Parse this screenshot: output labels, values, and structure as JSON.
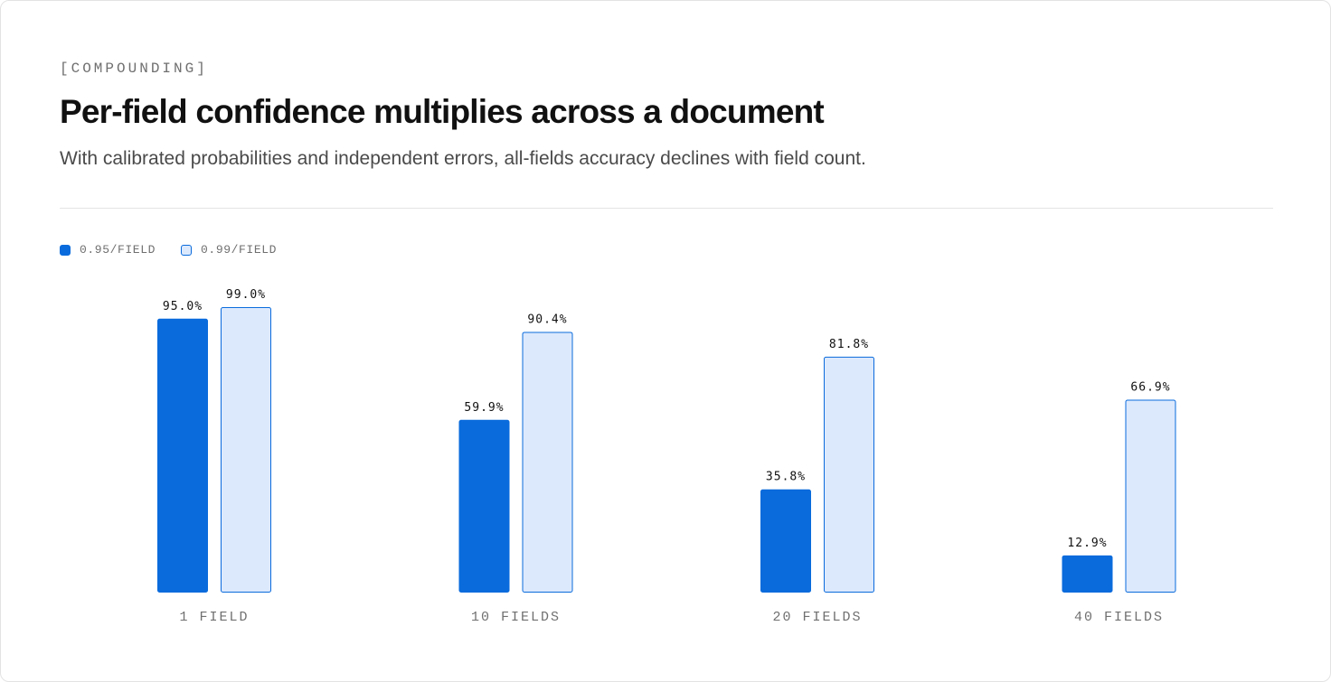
{
  "eyebrow": "[COMPOUNDING]",
  "title": "Per-field confidence multiplies across a document",
  "subtitle": "With calibrated probabilities and independent errors, all-fields accuracy declines with field count.",
  "colors": {
    "primary_fill": "#0a6bdc",
    "secondary_fill": "#dce9fd",
    "secondary_stroke": "#0a6bdc"
  },
  "legend": [
    {
      "label": "0.95/FIELD"
    },
    {
      "label": "0.99/FIELD"
    }
  ],
  "chart_data": {
    "type": "bar",
    "categories": [
      "1 FIELD",
      "10 FIELDS",
      "20 FIELDS",
      "40 FIELDS"
    ],
    "series": [
      {
        "name": "0.95/FIELD",
        "values": [
          95.0,
          59.9,
          35.8,
          12.9
        ],
        "labels": [
          "95.0%",
          "59.9%",
          "35.8%",
          "12.9%"
        ]
      },
      {
        "name": "0.99/FIELD",
        "values": [
          99.0,
          90.4,
          81.8,
          66.9
        ],
        "labels": [
          "99.0%",
          "90.4%",
          "81.8%",
          "66.9%"
        ]
      }
    ],
    "ylim": [
      0,
      100
    ],
    "grid": false,
    "legend_position": "top-left"
  }
}
